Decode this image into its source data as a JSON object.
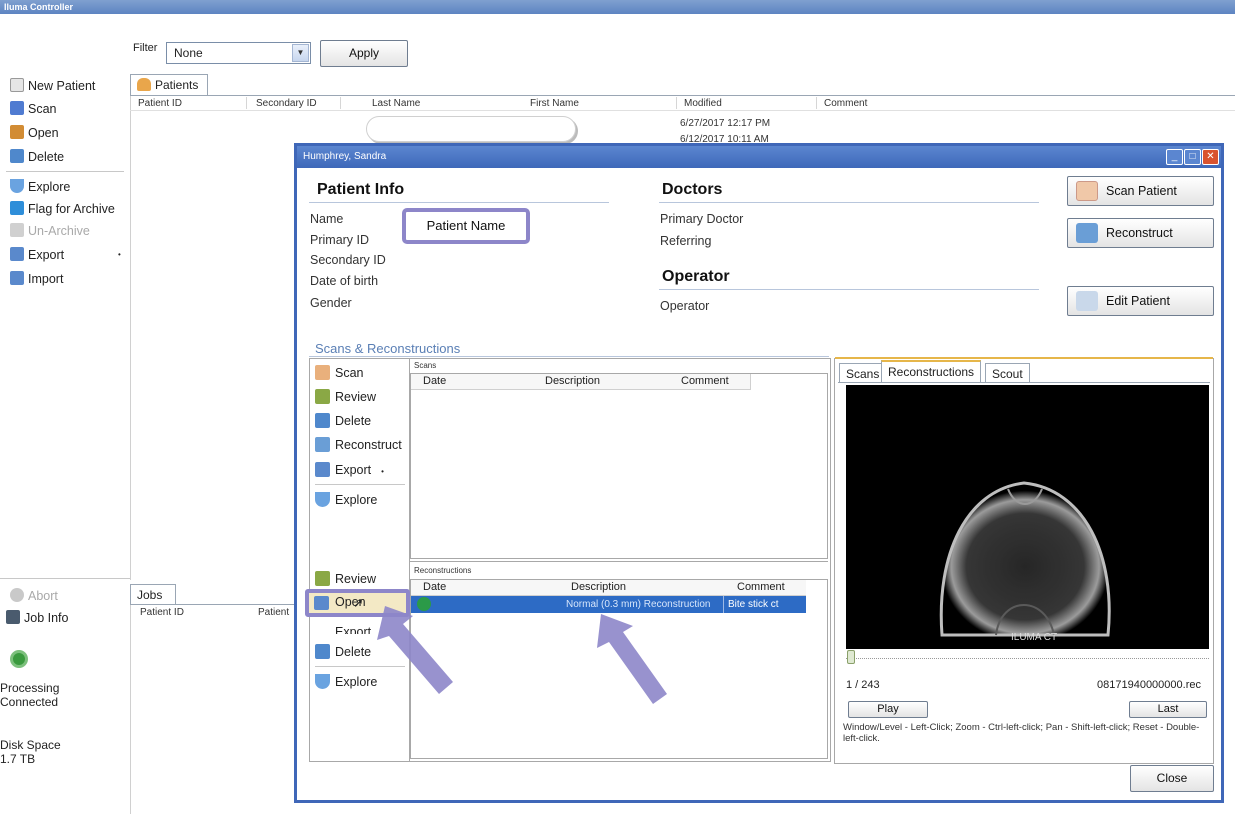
{
  "app": {
    "title": "Iluma Controller"
  },
  "filter": {
    "label": "Filter",
    "value": "None",
    "apply_label": "Apply"
  },
  "sidebar": {
    "items": [
      {
        "label": "New Patient",
        "icon": "new-patient-icon",
        "color": "#d9d9d9"
      },
      {
        "label": "Scan",
        "icon": "scan-icon",
        "color": "#4f7bd1"
      },
      {
        "label": "Open",
        "icon": "open-icon",
        "color": "#d28c34"
      },
      {
        "label": "Delete",
        "icon": "delete-icon",
        "color": "#4f88cc"
      },
      {
        "label": "Explore",
        "icon": "explore-icon",
        "color": "#6aa3e0"
      },
      {
        "label": "Flag for Archive",
        "icon": "archive-flag-icon",
        "color": "#2e8ed9"
      },
      {
        "label": "Un-Archive",
        "icon": "unarchive-icon",
        "color": "#d0d0d0"
      },
      {
        "label": "Export",
        "icon": "export-icon",
        "color": "#5a89cc"
      },
      {
        "label": "Import",
        "icon": "import-icon",
        "color": "#5a89cc"
      }
    ]
  },
  "patients_tab": {
    "label": "Patients",
    "columns": [
      "Patient ID",
      "Secondary ID",
      "Last Name",
      "First Name",
      "Modified",
      "Comment"
    ],
    "modified_values": [
      "6/27/2017 12:17 PM",
      "6/12/2017 10:11 AM"
    ]
  },
  "bottom_left": {
    "abort_label": "Abort",
    "job_info_label": "Job Info",
    "processing_label": "Processing",
    "connected_label": "Connected",
    "disk_space_label": "Disk Space",
    "disk_space_value": "1.7 TB"
  },
  "jobs_tab": {
    "label": "Jobs",
    "columns": [
      "Patient ID",
      "Patient"
    ]
  },
  "dialog": {
    "title": "Humphrey, Sandra",
    "patient_info": {
      "title": "Patient Info",
      "fields": [
        "Name",
        "Primary ID",
        "Secondary ID",
        "Date of birth",
        "Gender"
      ],
      "name_box": "Patient Name"
    },
    "doctors": {
      "title": "Doctors",
      "fields": [
        "Primary Doctor",
        "Referring"
      ]
    },
    "operator": {
      "title": "Operator",
      "field": "Operator"
    },
    "buttons": {
      "scan_patient": "Scan Patient",
      "reconstruct": "Reconstruct",
      "edit_patient": "Edit Patient",
      "close": "Close"
    },
    "scans_recon": {
      "title": "Scans & Reconstructions",
      "scan_actions": [
        "Scan",
        "Review",
        "Delete",
        "Reconstruct",
        "Export",
        "Explore"
      ],
      "scans_label": "Scans",
      "scans_columns": [
        "Date",
        "Description",
        "Comment"
      ],
      "recon_actions": [
        "Review",
        "Open",
        "Export",
        "Delete",
        "Explore"
      ],
      "recon_label": "Reconstructions",
      "recon_columns": [
        "Date",
        "Description",
        "Comment"
      ],
      "recon_row": {
        "description": "Normal (0.3 mm) Reconstruction",
        "comment": "Bite stick ct"
      }
    },
    "viewer": {
      "tabs": [
        "Scans",
        "Reconstructions",
        "Scout"
      ],
      "active_tab": "Reconstructions",
      "watermark": "ILUMA CT",
      "frame": "1 / 243",
      "filename": "08171940000000.rec",
      "play_label": "Play",
      "last_label": "Last",
      "hint": "Window/Level - Left-Click;  Zoom - Ctrl-left-click; Pan - Shift-left-click; Reset - Double-left-click."
    }
  },
  "colors": {
    "title_bar": "#3e68b9",
    "selection": "#2d6bc5",
    "annotation": "#8d86c9"
  }
}
